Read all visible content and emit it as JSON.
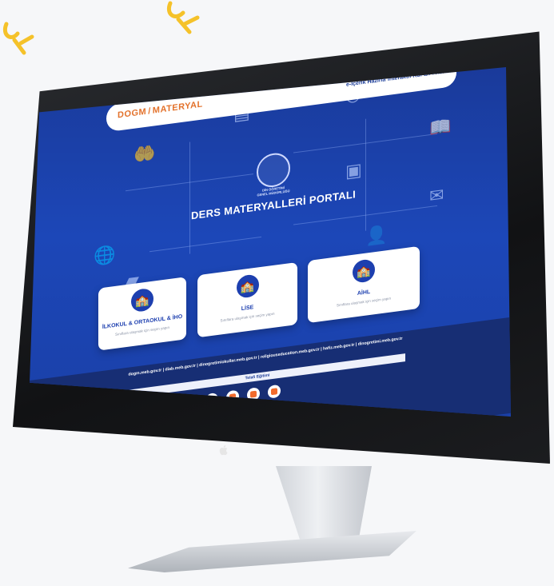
{
  "colors": {
    "accent": "#1d3faf",
    "logo": "#e3722c",
    "footer": "#172e74",
    "squiggle": "#f5c22a"
  },
  "site": {
    "logo_part1": "DOGM",
    "logo_part2": "MATERYAL",
    "nav": [
      "e-İçerik Hazırla",
      "İnteraktif Kur'an-ı Kerim"
    ],
    "hero_sub_line1": "DİN ÖĞRETİMİ",
    "hero_sub_line2": "GENEL MÜDÜRLÜĞÜ",
    "hero_title": "DERS MATERYALLERİ PORTALI"
  },
  "cards": [
    {
      "title": "İLKOKUL & ORTAOKUL & İHO",
      "subtitle": "Sınıflara ulaşmak için seçim yapın",
      "icon": "school-building-icon"
    },
    {
      "title": "LİSE",
      "subtitle": "Sınıflara ulaşmak için seçim yapın",
      "icon": "school-building-icon"
    },
    {
      "title": "AİHL",
      "subtitle": "Sınıflara ulaşmak için seçim yapın",
      "icon": "school-building-icon"
    }
  ],
  "footer": {
    "links": "dogm.meb.gov.tr | diab.meb.gov.tr | dinogretimiokullar.meb.gov.tr | religiouseducation.meb.gov.tr | hafiz.meb.gov.tr | dinogretimi.meb.gov.tr",
    "telafi": "Telafi Eğitimi",
    "socials": [
      "instagram-icon",
      "twitter-icon",
      "youtube-icon",
      "telegram-icon"
    ]
  }
}
